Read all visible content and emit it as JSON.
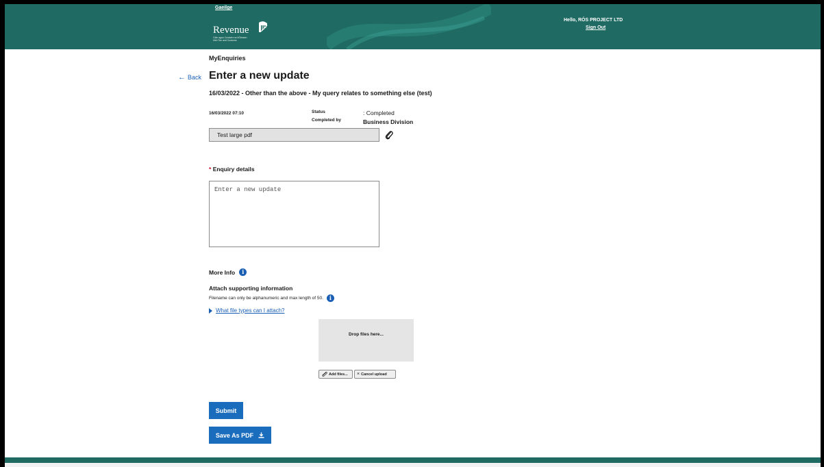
{
  "header": {
    "language_link": "Gaeilge",
    "logo_word": "Revenue",
    "logo_tagline_1": "Cáin agus Custaim na hÉireann",
    "logo_tagline_2": "Irish Tax and Customs",
    "greeting": "Hello, RÓS PROJECT LTD",
    "sign_out": "Sign Out",
    "brand_color": "#1f6b63"
  },
  "breadcrumb": "MyEnquiries",
  "back_label": "Back",
  "page_title": "Enter a new update",
  "subtitle": "16/03/2022 - Other than the above - My query relates to something else (test)",
  "meta": {
    "date": "16/03/2022 07:10",
    "status_label": "Status",
    "status_value": ": Completed",
    "completed_by_label": "Completed by",
    "completed_by_value": "Business Division"
  },
  "attachment": {
    "name": "Test large pdf",
    "icon": "paperclip-icon"
  },
  "enquiry": {
    "required_marker": "*",
    "label": "Enquiry details",
    "placeholder": "Enter a new update",
    "value": ""
  },
  "more_info": {
    "label": "More Info",
    "icon": "info-icon"
  },
  "supporting": {
    "heading": "Attach supporting information",
    "filename_note": "Filename can only be alphanumeric and max length of 50.",
    "file_types_link": "What file types can I attach?",
    "drop_text": "Drop files here...",
    "add_files": "Add files...",
    "cancel_upload": "Cancel upload"
  },
  "actions": {
    "submit": "Submit",
    "save_pdf": "Save As PDF",
    "accent_color": "#1a6dbd"
  }
}
